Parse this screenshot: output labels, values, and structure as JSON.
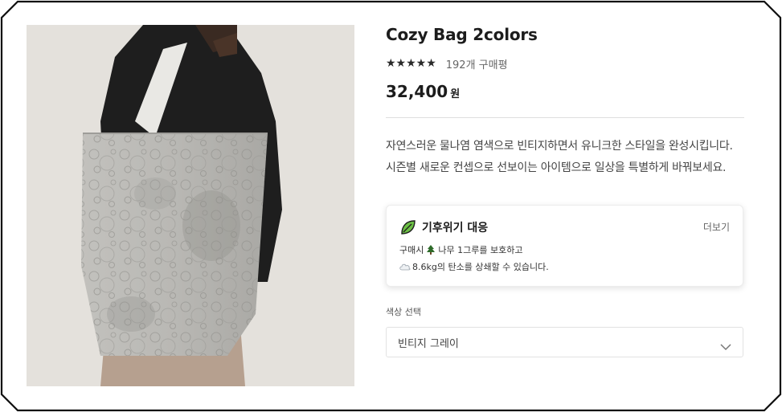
{
  "product": {
    "title": "Cozy Bag 2colors",
    "stars": "★★★★★",
    "review_count": "192개 구매평",
    "price": "32,400",
    "price_unit": "원",
    "description": "자연스러운 물나염 염색으로 빈티지하면서 유니크한 스타일을 완성시킵니다. 시즌별 새로운 컨셉으로 선보이는 아이템으로 일상을 특별하게 바꿔보세요."
  },
  "climate": {
    "icon": "leaf-icon",
    "title": "기후위기 대응",
    "more_label": "더보기",
    "line1_prefix": "구매시",
    "line1_icon": "tree-icon",
    "line1_suffix": "나무 1그루를 보호하고",
    "line2_icon": "cloud-icon",
    "line2_text": "8.6kg의 탄소를 상쇄할 수 있습니다."
  },
  "options": {
    "color_label": "색상 선택",
    "color_selected": "빈티지 그레이"
  },
  "colors": {
    "leaf_green": "#5fae3c",
    "image_bg": "#e4e1dc",
    "bag_gray": "#b7b6b2"
  }
}
